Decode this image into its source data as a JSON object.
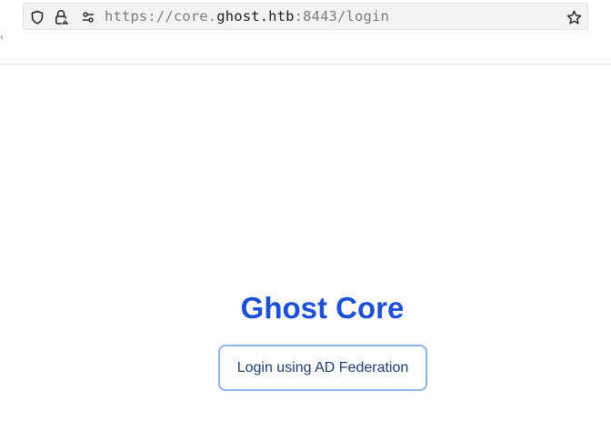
{
  "browser": {
    "url_scheme": "https://",
    "url_subdomain": "core.",
    "url_host": "ghost.htb",
    "url_rest": ":8443/login",
    "icons": {
      "shield": "shield-icon",
      "lock": "lock-warning-icon",
      "permissions": "permissions-icon",
      "bookmark": "star-icon"
    }
  },
  "page": {
    "title": "Ghost Core",
    "login_button_label": "Login using AD Federation"
  },
  "colors": {
    "title": "#1c4fd8",
    "button_border": "#8cb3ea",
    "button_text": "#213d73"
  }
}
